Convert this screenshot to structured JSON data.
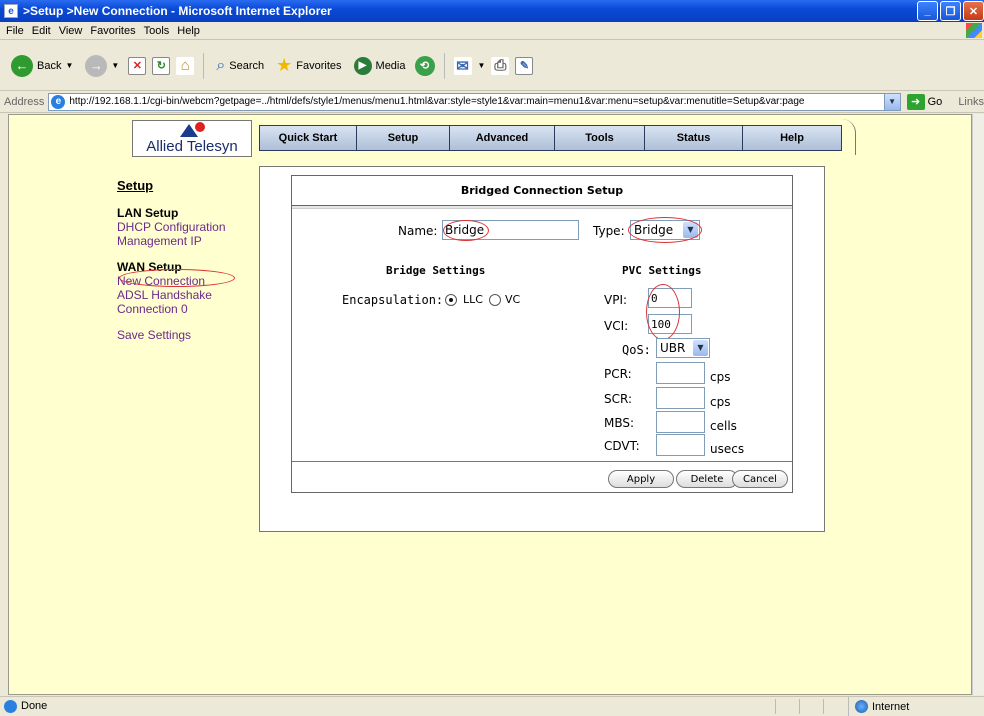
{
  "window": {
    "title": ">Setup >New Connection - Microsoft Internet Explorer"
  },
  "menu": [
    "File",
    "Edit",
    "View",
    "Favorites",
    "Tools",
    "Help"
  ],
  "toolbar": {
    "back": "Back",
    "search": "Search",
    "favorites": "Favorites",
    "media": "Media"
  },
  "address": {
    "label": "Address",
    "url": "http://192.168.1.1/cgi-bin/webcm?getpage=../html/defs/style1/menus/menu1.html&var:style=style1&var:main=menu1&var:menu=setup&var:menutitle=Setup&var:page",
    "go": "Go",
    "links": "Links"
  },
  "status": {
    "text": "Done",
    "zone": "Internet"
  },
  "logo": {
    "text": "Allied Telesyn"
  },
  "nav": [
    {
      "label": "Quick Start"
    },
    {
      "label": "Setup"
    },
    {
      "label": "Advanced"
    },
    {
      "label": "Tools"
    },
    {
      "label": "Status"
    },
    {
      "label": "Help"
    }
  ],
  "sidebar": {
    "title": "Setup",
    "lan_header": "LAN Setup",
    "lan_items": [
      "DHCP Configuration",
      "Management IP"
    ],
    "wan_header": "WAN Setup",
    "wan_items": [
      "New Connection",
      "ADSL Handshake",
      "Connection 0"
    ],
    "save": "Save Settings"
  },
  "form": {
    "title": "Bridged Connection Setup",
    "name_label": "Name:",
    "name_value": "Bridge",
    "type_label": "Type:",
    "type_value": "Bridge",
    "bridge_header": "Bridge Settings",
    "pvc_header": "PVC Settings",
    "encap_label": "Encapsulation:",
    "encap_llc": "LLC",
    "encap_vc": "VC",
    "vpi_label": "VPI:",
    "vpi_value": "0",
    "vci_label": "VCI:",
    "vci_value": "100",
    "qos_label": "QoS:",
    "qos_value": "UBR",
    "pcr_label": "PCR:",
    "pcr_unit": "cps",
    "scr_label": "SCR:",
    "scr_unit": "cps",
    "mbs_label": "MBS:",
    "mbs_unit": "cells",
    "cdvt_label": "CDVT:",
    "cdvt_unit": "usecs",
    "apply": "Apply",
    "delete": "Delete",
    "cancel": "Cancel"
  }
}
